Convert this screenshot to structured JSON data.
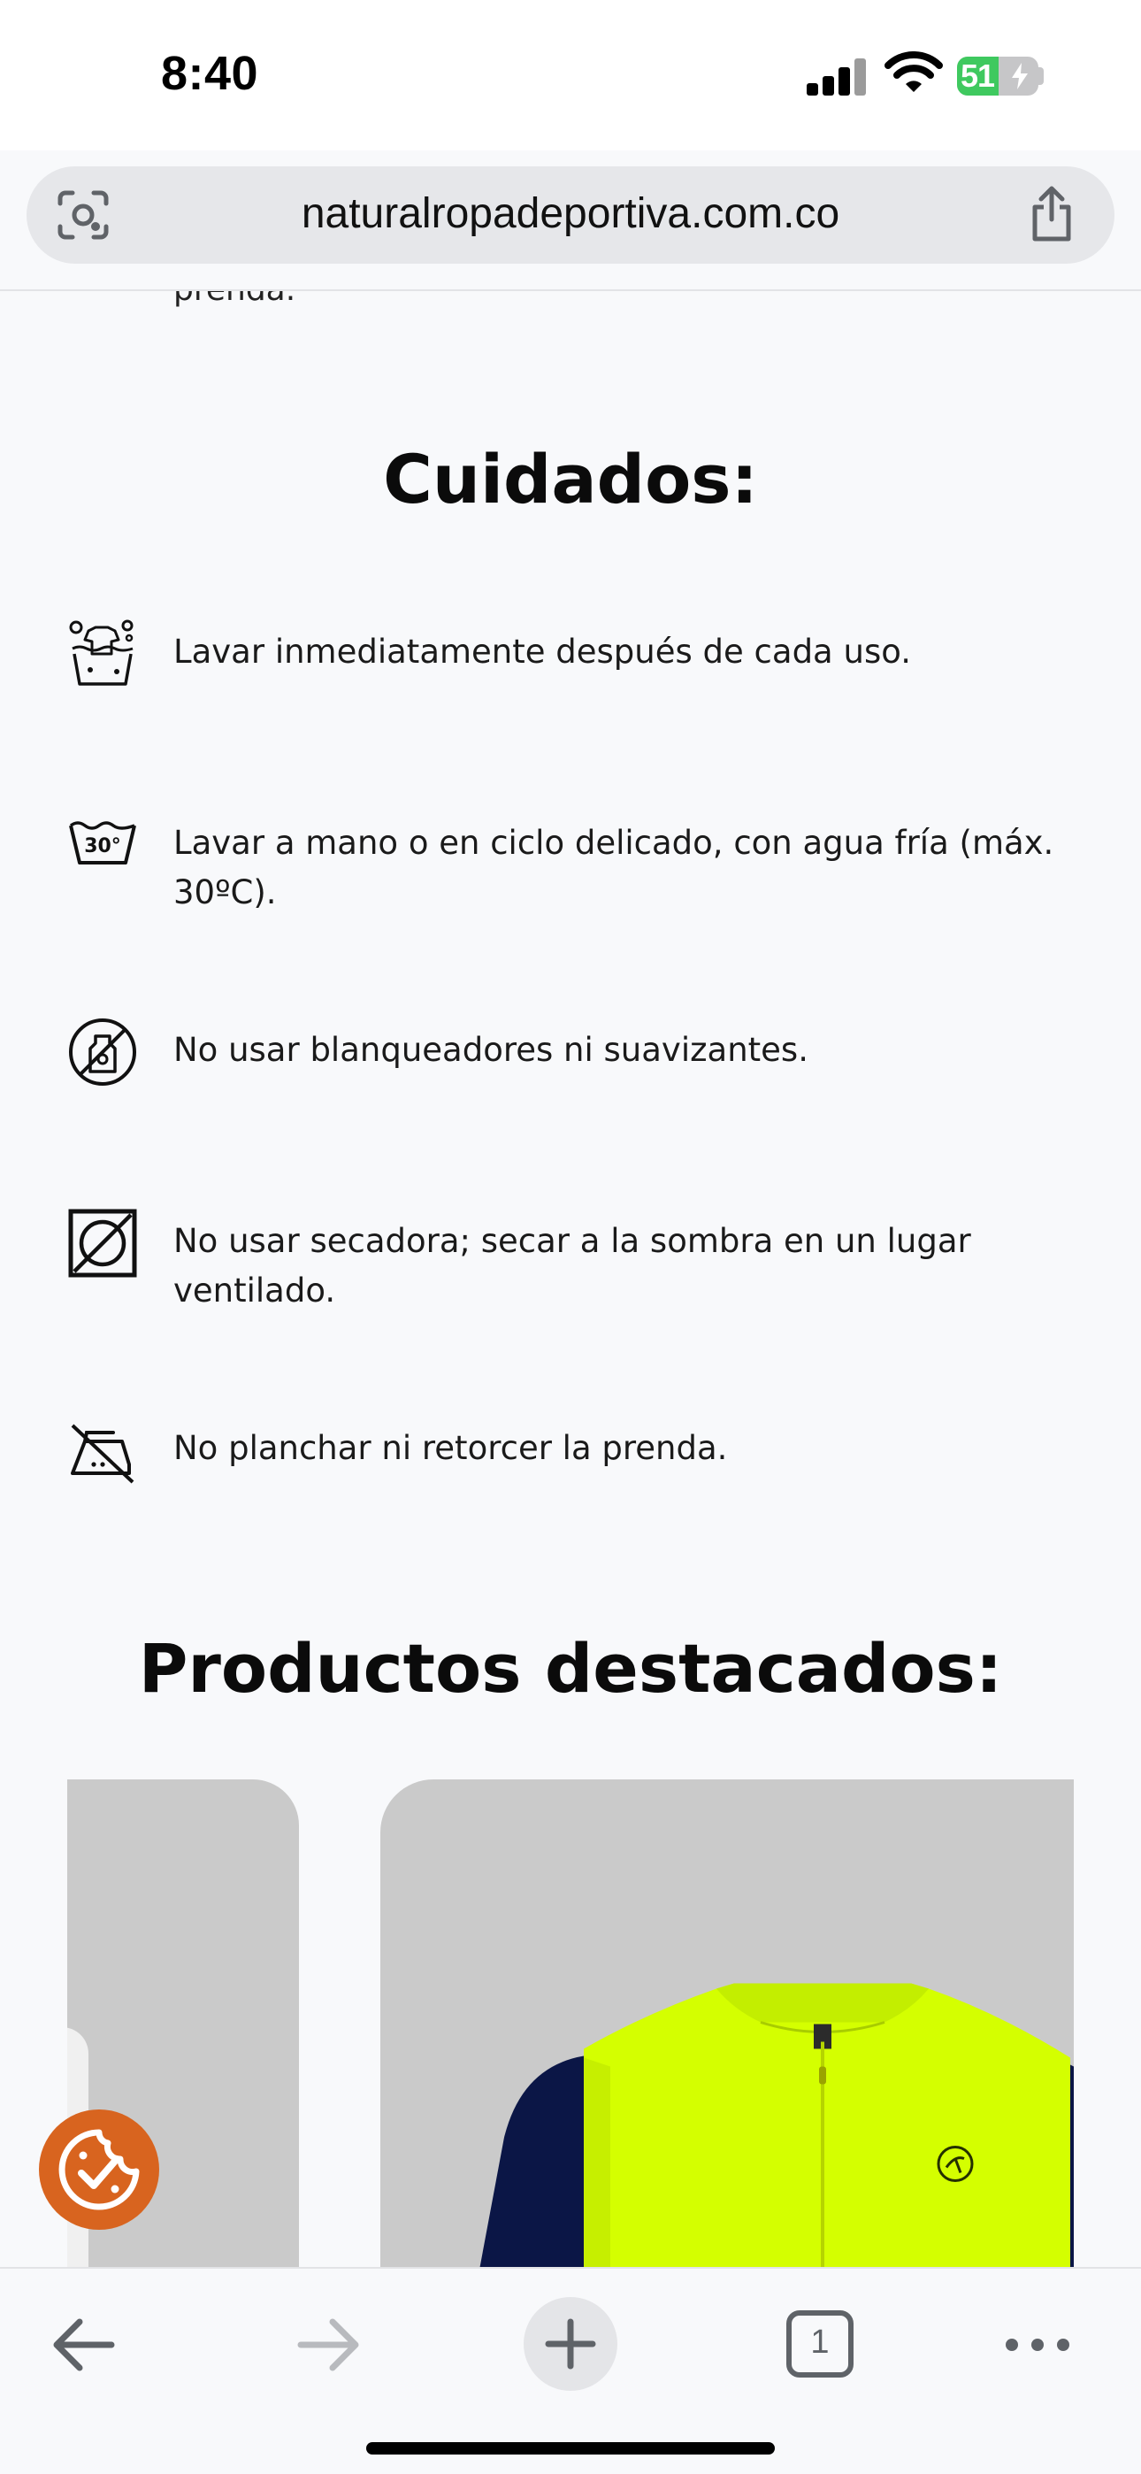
{
  "status_bar": {
    "time": "8:40",
    "battery_level": "51",
    "icons": [
      "cellular-signal-icon",
      "wifi-icon",
      "battery-charging-icon"
    ]
  },
  "browser": {
    "url": "naturalropadeportiva.com.co",
    "icons": [
      "visual-search-icon",
      "share-icon"
    ]
  },
  "page": {
    "cut_text": "prenda.",
    "care_title": "Cuidados:",
    "care_items": [
      {
        "icon": "hand-wash-icon",
        "text": "Lavar inmediatamente después de cada uso."
      },
      {
        "icon": "wash-30-icon",
        "text": "Lavar a mano o en ciclo delicado, con agua fría (máx. 30ºC)."
      },
      {
        "icon": "no-bleach-icon",
        "text": "No usar blanqueadores ni suavizantes."
      },
      {
        "icon": "no-tumble-dry-icon",
        "text": "No usar secadora; secar a la sombra en un lugar ventilado."
      },
      {
        "icon": "no-iron-icon",
        "text": "No planchar ni retorcer la prenda."
      }
    ],
    "products_title": "Productos destacados:",
    "products": [
      {
        "image": "white-garment-partial"
      },
      {
        "image": "neon-yellow-navy-cycling-jersey",
        "colors": {
          "body": "#d4ff00",
          "sleeves": "#0b1646"
        }
      }
    ],
    "icon_wash_label": "30°"
  },
  "cookie_button": {
    "icon": "cookie-consent-icon",
    "color": "#d8641f"
  },
  "toolbar": {
    "tab_count": "1",
    "icons": [
      "back-arrow-icon",
      "forward-arrow-icon",
      "new-tab-plus-icon",
      "tabs-icon",
      "more-icon"
    ]
  }
}
